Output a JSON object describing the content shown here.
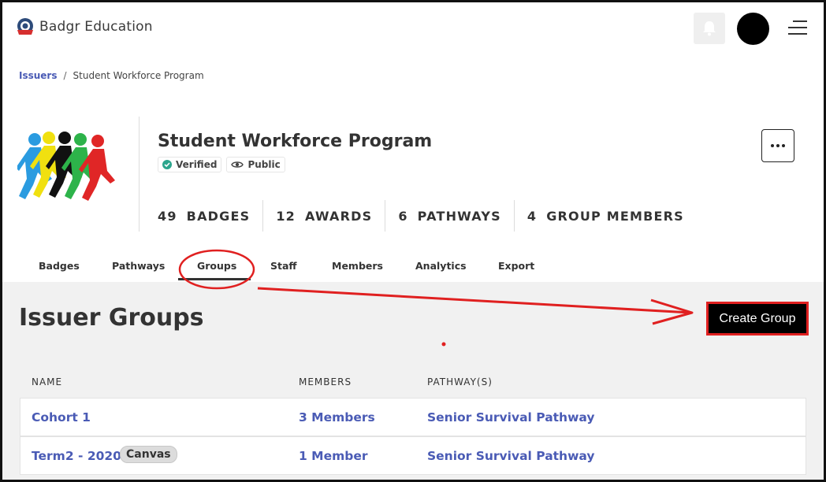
{
  "app": {
    "name": "Badgr Education"
  },
  "breadcrumb": {
    "link": "Issuers",
    "separator": "/",
    "current": "Student Workforce Program"
  },
  "issuer": {
    "name": "Student Workforce Program",
    "verified_label": "Verified",
    "visibility_label": "Public",
    "stats": [
      {
        "value": "49",
        "label": "BADGES"
      },
      {
        "value": "12",
        "label": "AWARDS"
      },
      {
        "value": "6",
        "label": "PATHWAYS"
      },
      {
        "value": "4",
        "label": "GROUP MEMBERS"
      }
    ]
  },
  "tabs": [
    {
      "label": "Badges"
    },
    {
      "label": "Pathways"
    },
    {
      "label": "Groups",
      "active": true
    },
    {
      "label": "Staff"
    },
    {
      "label": "Members"
    },
    {
      "label": "Analytics"
    },
    {
      "label": "Export"
    }
  ],
  "groups_page": {
    "title": "Issuer Groups",
    "create_button": "Create Group",
    "columns": [
      "NAME",
      "MEMBERS",
      "PATHWAY(S)"
    ],
    "rows": [
      {
        "name": "Cohort 1",
        "tag": "",
        "members": "3 Members",
        "pathway": "Senior Survival Pathway"
      },
      {
        "name": "Term2 - 2020",
        "tag": "Canvas",
        "members": "1 Member",
        "pathway": "Senior Survival Pathway"
      }
    ]
  },
  "colors": {
    "link": "#4a5bb5",
    "verified": "#2ca58d",
    "annotation": "#e02020"
  },
  "icons": [
    "badgr-logo-icon",
    "bell-icon",
    "hamburger-menu-icon",
    "verified-check-icon",
    "eye-icon",
    "more-dots-icon"
  ]
}
